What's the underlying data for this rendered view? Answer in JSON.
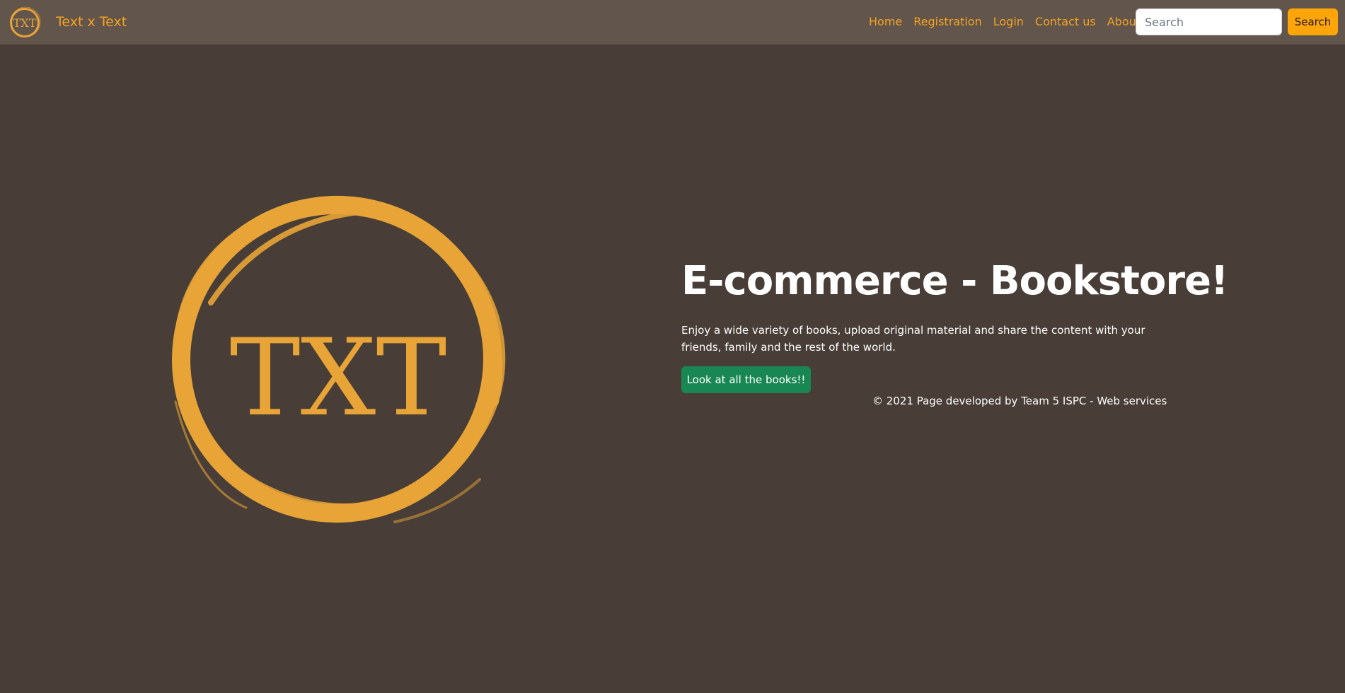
{
  "navbar": {
    "brand": "Text x Text",
    "logo_text": "TXT",
    "links": [
      "Home",
      "Registration",
      "Login",
      "Contact us",
      "About us"
    ],
    "search": {
      "placeholder": "Search",
      "value": ""
    },
    "search_button": "Search"
  },
  "hero": {
    "logo_text": "TXT",
    "title": "E-commerce - Bookstore!",
    "description": "Enjoy a wide variety of books, upload original material and share the content with your friends, family and the rest of the world.",
    "button": "Look at all the books!!"
  },
  "footer": {
    "text": "© 2021 Page developed by Team 5 ISPC - Web services"
  },
  "colors": {
    "page_bg": "#483e37",
    "navbar_bg": "#62554c",
    "accent": "#f5a320",
    "logo": "#e8a436",
    "search_button": "#ffa50a",
    "books_button": "#198754"
  }
}
